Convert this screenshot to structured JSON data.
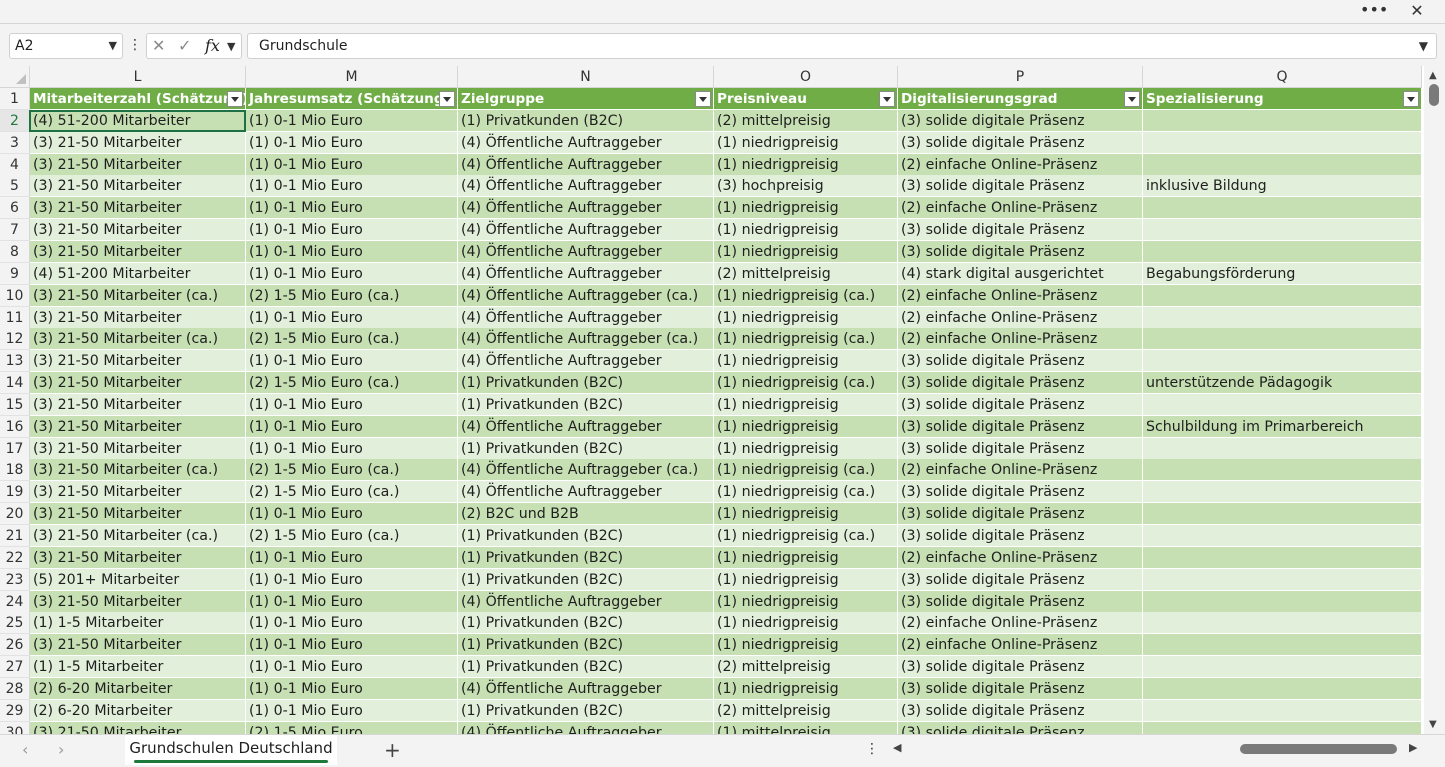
{
  "window": {
    "more_icon": "more-horizontal-icon",
    "close_icon": "close-icon"
  },
  "formula_bar": {
    "name_box": "A2",
    "formula": "Grundschule"
  },
  "columns": [
    "L",
    "M",
    "N",
    "O",
    "P",
    "Q"
  ],
  "header_row": [
    "Mitarbeiterzahl (Schätzung)",
    "Jahresumsatz (Schätzung)",
    "Zielgruppe",
    "Preisniveau",
    "Digitalisierungsgrad",
    "Spezialisierung"
  ],
  "rows": [
    [
      "2",
      "(4) 51-200 Mitarbeiter",
      "(1) 0-1 Mio Euro",
      "(1) Privatkunden (B2C)",
      "(2) mittelpreisig",
      "(3) solide digitale Präsenz",
      ""
    ],
    [
      "3",
      "(3) 21-50 Mitarbeiter",
      "(1) 0-1 Mio Euro",
      "(4) Öffentliche Auftraggeber",
      "(1) niedrigpreisig",
      "(3) solide digitale Präsenz",
      ""
    ],
    [
      "4",
      "(3) 21-50 Mitarbeiter",
      "(1) 0-1 Mio Euro",
      "(4) Öffentliche Auftraggeber",
      "(1) niedrigpreisig",
      "(2) einfache Online-Präsenz",
      ""
    ],
    [
      "5",
      "(3) 21-50 Mitarbeiter",
      "(1) 0-1 Mio Euro",
      "(4) Öffentliche Auftraggeber",
      "(3) hochpreisig",
      "(3) solide digitale Präsenz",
      "inklusive Bildung"
    ],
    [
      "6",
      "(3) 21-50 Mitarbeiter",
      "(1) 0-1 Mio Euro",
      "(4) Öffentliche Auftraggeber",
      "(1) niedrigpreisig",
      "(2) einfache Online-Präsenz",
      ""
    ],
    [
      "7",
      "(3) 21-50 Mitarbeiter",
      "(1) 0-1 Mio Euro",
      "(4) Öffentliche Auftraggeber",
      "(1) niedrigpreisig",
      "(3) solide digitale Präsenz",
      ""
    ],
    [
      "8",
      "(3) 21-50 Mitarbeiter",
      "(1) 0-1 Mio Euro",
      "(4) Öffentliche Auftraggeber",
      "(1) niedrigpreisig",
      "(3) solide digitale Präsenz",
      ""
    ],
    [
      "9",
      "(4) 51-200 Mitarbeiter",
      "(1) 0-1 Mio Euro",
      "(4) Öffentliche Auftraggeber",
      "(2) mittelpreisig",
      "(4) stark digital ausgerichtet",
      "Begabungsförderung"
    ],
    [
      "10",
      "(3) 21-50 Mitarbeiter (ca.)",
      "(2) 1-5 Mio Euro (ca.)",
      "(4) Öffentliche Auftraggeber (ca.)",
      "(1) niedrigpreisig (ca.)",
      "(2) einfache Online-Präsenz",
      ""
    ],
    [
      "11",
      "(3) 21-50 Mitarbeiter",
      "(1) 0-1 Mio Euro",
      "(4) Öffentliche Auftraggeber",
      "(1) niedrigpreisig",
      "(2) einfache Online-Präsenz",
      ""
    ],
    [
      "12",
      "(3) 21-50 Mitarbeiter (ca.)",
      "(2) 1-5 Mio Euro (ca.)",
      "(4) Öffentliche Auftraggeber (ca.)",
      "(1) niedrigpreisig (ca.)",
      "(2) einfache Online-Präsenz",
      ""
    ],
    [
      "13",
      "(3) 21-50 Mitarbeiter",
      "(1) 0-1 Mio Euro",
      "(4) Öffentliche Auftraggeber",
      "(1) niedrigpreisig",
      "(3) solide digitale Präsenz",
      ""
    ],
    [
      "14",
      "(3) 21-50 Mitarbeiter",
      "(2) 1-5 Mio Euro (ca.)",
      "(1) Privatkunden (B2C)",
      "(1) niedrigpreisig (ca.)",
      "(3) solide digitale Präsenz",
      "unterstützende Pädagogik"
    ],
    [
      "15",
      "(3) 21-50 Mitarbeiter",
      "(1) 0-1 Mio Euro",
      "(1) Privatkunden (B2C)",
      "(1) niedrigpreisig",
      "(3) solide digitale Präsenz",
      ""
    ],
    [
      "16",
      "(3) 21-50 Mitarbeiter",
      "(1) 0-1 Mio Euro",
      "(4) Öffentliche Auftraggeber",
      "(1) niedrigpreisig",
      "(3) solide digitale Präsenz",
      "Schulbildung im Primarbereich"
    ],
    [
      "17",
      "(3) 21-50 Mitarbeiter",
      "(1) 0-1 Mio Euro",
      "(1) Privatkunden (B2C)",
      "(1) niedrigpreisig",
      "(3) solide digitale Präsenz",
      ""
    ],
    [
      "18",
      "(3) 21-50 Mitarbeiter (ca.)",
      "(2) 1-5 Mio Euro (ca.)",
      "(4) Öffentliche Auftraggeber (ca.)",
      "(1) niedrigpreisig (ca.)",
      "(2) einfache Online-Präsenz",
      ""
    ],
    [
      "19",
      "(3) 21-50 Mitarbeiter",
      "(2) 1-5 Mio Euro (ca.)",
      "(4) Öffentliche Auftraggeber",
      "(1) niedrigpreisig (ca.)",
      "(3) solide digitale Präsenz",
      ""
    ],
    [
      "20",
      "(3) 21-50 Mitarbeiter",
      "(1) 0-1 Mio Euro",
      "(2) B2C und B2B",
      "(1) niedrigpreisig",
      "(3) solide digitale Präsenz",
      ""
    ],
    [
      "21",
      "(3) 21-50 Mitarbeiter (ca.)",
      "(2) 1-5 Mio Euro (ca.)",
      "(1) Privatkunden (B2C)",
      "(1) niedrigpreisig (ca.)",
      "(3) solide digitale Präsenz",
      ""
    ],
    [
      "22",
      "(3) 21-50 Mitarbeiter",
      "(1) 0-1 Mio Euro",
      "(1) Privatkunden (B2C)",
      "(1) niedrigpreisig",
      "(2) einfache Online-Präsenz",
      ""
    ],
    [
      "23",
      "(5) 201+ Mitarbeiter",
      "(1) 0-1 Mio Euro",
      "(1) Privatkunden (B2C)",
      "(1) niedrigpreisig",
      "(3) solide digitale Präsenz",
      ""
    ],
    [
      "24",
      "(3) 21-50 Mitarbeiter",
      "(1) 0-1 Mio Euro",
      "(4) Öffentliche Auftraggeber",
      "(1) niedrigpreisig",
      "(3) solide digitale Präsenz",
      ""
    ],
    [
      "25",
      "(1) 1-5 Mitarbeiter",
      "(1) 0-1 Mio Euro",
      "(1) Privatkunden (B2C)",
      "(1) niedrigpreisig",
      "(2) einfache Online-Präsenz",
      ""
    ],
    [
      "26",
      "(3) 21-50 Mitarbeiter",
      "(1) 0-1 Mio Euro",
      "(1) Privatkunden (B2C)",
      "(1) niedrigpreisig",
      "(2) einfache Online-Präsenz",
      ""
    ],
    [
      "27",
      "(1) 1-5 Mitarbeiter",
      "(1) 0-1 Mio Euro",
      "(1) Privatkunden (B2C)",
      "(2) mittelpreisig",
      "(3) solide digitale Präsenz",
      ""
    ],
    [
      "28",
      "(2) 6-20 Mitarbeiter",
      "(1) 0-1 Mio Euro",
      "(4) Öffentliche Auftraggeber",
      "(1) niedrigpreisig",
      "(3) solide digitale Präsenz",
      ""
    ],
    [
      "29",
      "(2) 6-20 Mitarbeiter",
      "(1) 0-1 Mio Euro",
      "(1) Privatkunden (B2C)",
      "(2) mittelpreisig",
      "(3) solide digitale Präsenz",
      ""
    ],
    [
      "30",
      "(3) 21-50 Mitarbeiter",
      "(2) 1-5 Mio Euro",
      "(4) Öffentliche Auftraggeber",
      "(1) mittelpreisig",
      "(3) solide digitale Präsenz",
      ""
    ]
  ],
  "sheet_tab": "Grundschulen Deutschland",
  "colors": {
    "header_green": "#70ad47",
    "band_dark": "#c6e0b4",
    "band_light": "#e2efda",
    "accent": "#1d7a3b"
  }
}
